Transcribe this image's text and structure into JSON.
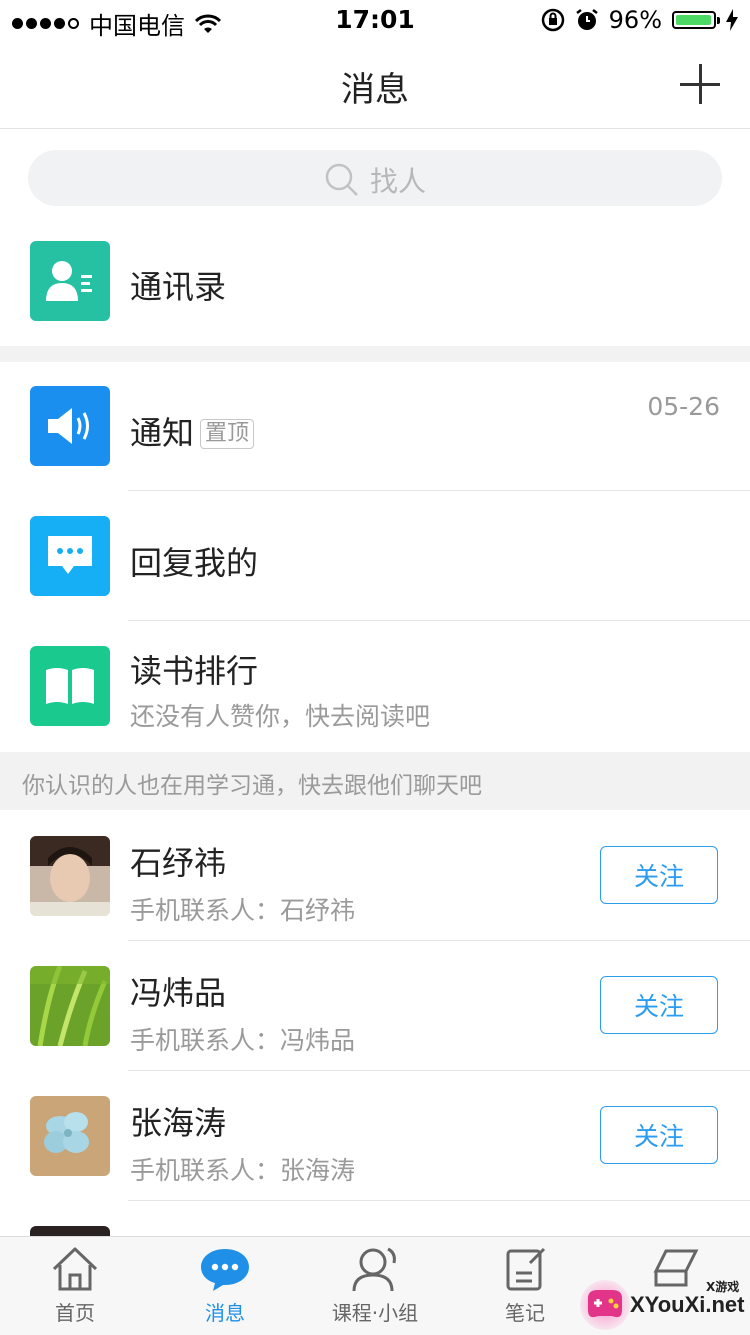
{
  "status_bar": {
    "carrier": "中国电信",
    "time": "17:01",
    "battery": "96%",
    "battery_level": 0.96
  },
  "header": {
    "title": "消息"
  },
  "search": {
    "placeholder": "找人"
  },
  "contacts_entry": {
    "label": "通讯录",
    "color": "#26c1a3"
  },
  "notice": {
    "title": "通知",
    "tag": "置顶",
    "date": "05-26",
    "color": "#1a8ff0"
  },
  "reply": {
    "title": "回复我的",
    "color": "#16aef5"
  },
  "reading": {
    "title": "读书排行",
    "subtitle": "还没有人赞你，快去阅读吧",
    "color": "#19c98e"
  },
  "hint": "你认识的人也在用学习通，快去跟他们聊天吧",
  "people": [
    {
      "name": "石纾祎",
      "subtitle": "手机联系人：石纾祎",
      "button": "关注"
    },
    {
      "name": "冯炜品",
      "subtitle": "手机联系人：冯炜品",
      "button": "关注"
    },
    {
      "name": "张海涛",
      "subtitle": "手机联系人：张海涛",
      "button": "关注"
    }
  ],
  "tabs": [
    {
      "label": "首页",
      "icon": "home-icon"
    },
    {
      "label": "消息",
      "icon": "chat-icon",
      "active": true
    },
    {
      "label": "课程·小组",
      "icon": "person-icon"
    },
    {
      "label": "笔记",
      "icon": "note-icon"
    },
    {
      "label": "",
      "icon": "folder-icon"
    }
  ],
  "watermark": {
    "text": "XYouXi.net",
    "small": "X游戏"
  },
  "colors": {
    "accent": "#2b9cf0",
    "battery": "#4cd964"
  }
}
